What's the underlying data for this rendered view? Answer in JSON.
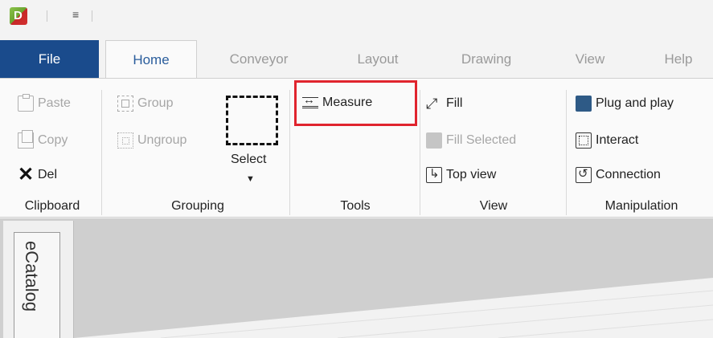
{
  "quick_access": {
    "app_icon_letter": "D",
    "dropdown_glyph": "≡"
  },
  "tabs": [
    "File",
    "Home",
    "Conveyor",
    "Layout",
    "Drawing",
    "View",
    "Help"
  ],
  "clipboard": {
    "paste": "Paste",
    "copy": "Copy",
    "del": "Del",
    "label": "Clipboard"
  },
  "grouping": {
    "group": "Group",
    "ungroup": "Ungroup",
    "select": "Select",
    "label": "Grouping"
  },
  "tools": {
    "measure": "Measure",
    "label": "Tools"
  },
  "view": {
    "fill": "Fill",
    "fill_selected": "Fill Selected",
    "top_view": "Top view",
    "label": "View"
  },
  "manipulation": {
    "plug_and_play": "Plug and play",
    "interact": "Interact",
    "connection": "Connection",
    "label": "Manipulation"
  },
  "side_panel": {
    "tab": "eCatalog"
  },
  "colors": {
    "file_tab": "#1a4b8c",
    "active_tab_text": "#2a5d9c",
    "highlight": "#e0242e"
  }
}
